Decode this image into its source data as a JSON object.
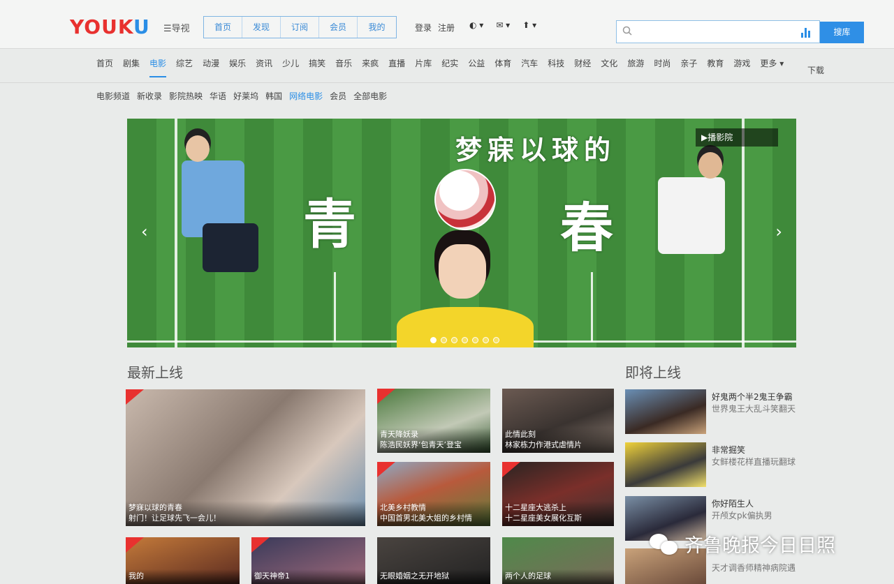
{
  "header": {
    "logo_main": "YOUK",
    "logo_end": "U",
    "nav_toggle": "☰导视",
    "topnav": [
      "首页",
      "发现",
      "订阅",
      "会员",
      "我的"
    ],
    "login": "登录",
    "register": "注册",
    "tools": [
      "◐ ▾",
      "✉ ▾",
      "⬆ ▾"
    ],
    "search_placeholder": "",
    "search_button": "搜库"
  },
  "channels": [
    "首页",
    "剧集",
    "电影",
    "综艺",
    "动漫",
    "娱乐",
    "资讯",
    "少儿",
    "搞笑",
    "音乐",
    "来疯",
    "直播",
    "片库",
    "纪实",
    "公益",
    "体育",
    "汽车",
    "科技",
    "财经",
    "文化",
    "旅游",
    "时尚",
    "亲子",
    "教育",
    "游戏",
    "更多 ▾"
  ],
  "channel_active_index": 2,
  "download_label": "下载",
  "subnav": [
    "电影频道",
    "新收录",
    "影院热映",
    "华语",
    "好莱坞",
    "韩国",
    "网络电影",
    "会员",
    "全部电影"
  ],
  "subnav_highlight_index": 6,
  "banner": {
    "title_top": "梦寐以球的",
    "title_left": "青",
    "title_right": "春",
    "theater_label": "▶播影院",
    "prev_arrow": "‹",
    "next_arrow": "›",
    "dots_total": 7,
    "dots_active": 0
  },
  "sections": {
    "latest": "最新上线",
    "upcoming": "即将上线"
  },
  "latest_cards": [
    {
      "title": "梦寐以球的青春",
      "subtitle": "射门！让足球先飞一会儿！"
    },
    {
      "title": "青天降妖录",
      "subtitle": "陈浩民妖界‘包青天’登宝"
    },
    {
      "title": "此情此刻",
      "subtitle": "林家栋力作港式虐情片"
    },
    {
      "title": "北美乡村教情",
      "subtitle": "中国首男北美大姐的乡村情"
    },
    {
      "title": "十二星座大逃杀上",
      "subtitle": "十二星座美女展化互斯"
    },
    {
      "title": "我的",
      "subtitle": ""
    },
    {
      "title": "御天神帝1",
      "subtitle": ""
    },
    {
      "title": "无眼婚姻之无开地狱",
      "subtitle": ""
    },
    {
      "title": "两个人的足球",
      "subtitle": ""
    }
  ],
  "upcoming_items": [
    {
      "title": "好鬼两个半2鬼王争霸",
      "desc": "世界鬼王大乱斗笑翻天"
    },
    {
      "title": "非常掘笑",
      "desc": "女鲜楼花样直播玩翻球"
    },
    {
      "title": "你好陌生人",
      "desc": "开颅女pk偏执男"
    },
    {
      "title": "",
      "desc": "天才调香师精神病院遇"
    }
  ],
  "watermark": "齐鲁晚报今日日照",
  "colors": {
    "brand_red": "#e8312f",
    "brand_blue": "#2a8ee6",
    "grass": "#3f8a3a"
  }
}
